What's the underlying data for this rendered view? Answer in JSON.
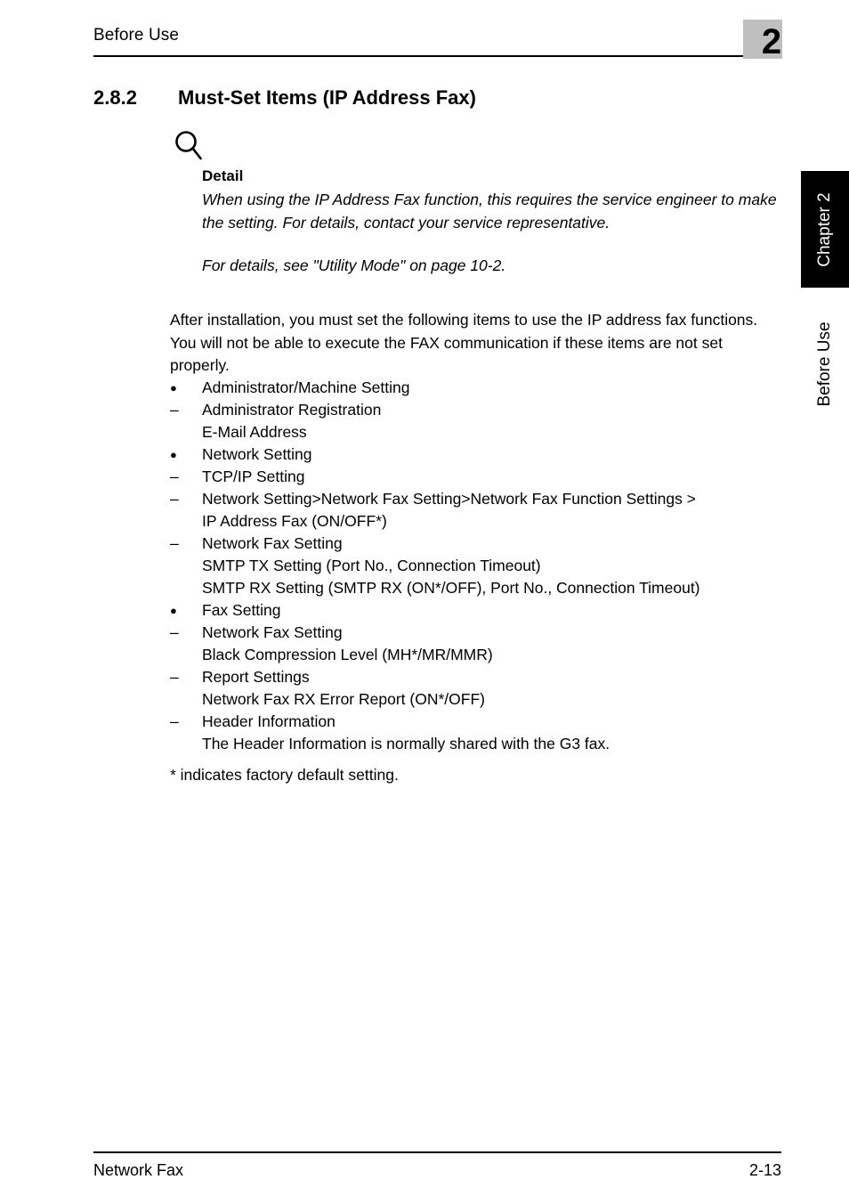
{
  "header": {
    "title": "Before Use",
    "chapter_number": "2",
    "chip_color": "#bfbfbf"
  },
  "section": {
    "number": "2.8.2",
    "title": "Must-Set Items (IP Address Fax)"
  },
  "note": {
    "icon": "magnifier-icon",
    "title": "Detail",
    "paragraph_1": "When using the IP Address Fax function, this requires the service engineer to make the setting. For details, contact your service representative.",
    "paragraph_2": "For details, see \"Utility Mode\" on page 10-2."
  },
  "body": {
    "intro": "After installation, you must set the following items to use the IP address fax functions. You will not be able to execute the FAX communication if these items are not set properly.",
    "items": [
      {
        "marker": "●",
        "type": "bullet",
        "text": "Administrator/Machine Setting"
      },
      {
        "marker": "–",
        "type": "dash",
        "text": "Administrator Registration"
      },
      {
        "marker": "",
        "type": "cont",
        "text": "E-Mail Address"
      },
      {
        "marker": "●",
        "type": "bullet",
        "text": "Network Setting"
      },
      {
        "marker": "–",
        "type": "dash",
        "text": "TCP/IP Setting"
      },
      {
        "marker": "–",
        "type": "dash",
        "text": "Network Setting>Network Fax Setting>Network Fax Function Settings >"
      },
      {
        "marker": "",
        "type": "cont",
        "text": "IP Address Fax (ON/OFF*)"
      },
      {
        "marker": "–",
        "type": "dash",
        "text": "Network Fax Setting"
      },
      {
        "marker": "",
        "type": "cont",
        "text": "SMTP TX Setting (Port No., Connection Timeout)"
      },
      {
        "marker": "",
        "type": "cont",
        "text": "SMTP RX Setting (SMTP RX (ON*/OFF), Port No., Connection Timeout)"
      },
      {
        "marker": "●",
        "type": "bullet",
        "text": "Fax Setting"
      },
      {
        "marker": "–",
        "type": "dash",
        "text": "Network Fax Setting"
      },
      {
        "marker": "",
        "type": "cont",
        "text": "Black Compression Level (MH*/MR/MMR)"
      },
      {
        "marker": "–",
        "type": "dash",
        "text": "Report Settings"
      },
      {
        "marker": "",
        "type": "cont",
        "text": "Network Fax RX Error Report (ON*/OFF)"
      },
      {
        "marker": "–",
        "type": "dash",
        "text": "Header Information"
      },
      {
        "marker": "",
        "type": "cont",
        "text": "The Header Information is normally shared with the G3 fax."
      }
    ],
    "footnote": "* indicates factory default setting."
  },
  "side_tabs": {
    "chapter_tab": "Chapter 2",
    "section_tab": "Before Use"
  },
  "footer": {
    "left": "Network Fax",
    "right": "2-13"
  }
}
